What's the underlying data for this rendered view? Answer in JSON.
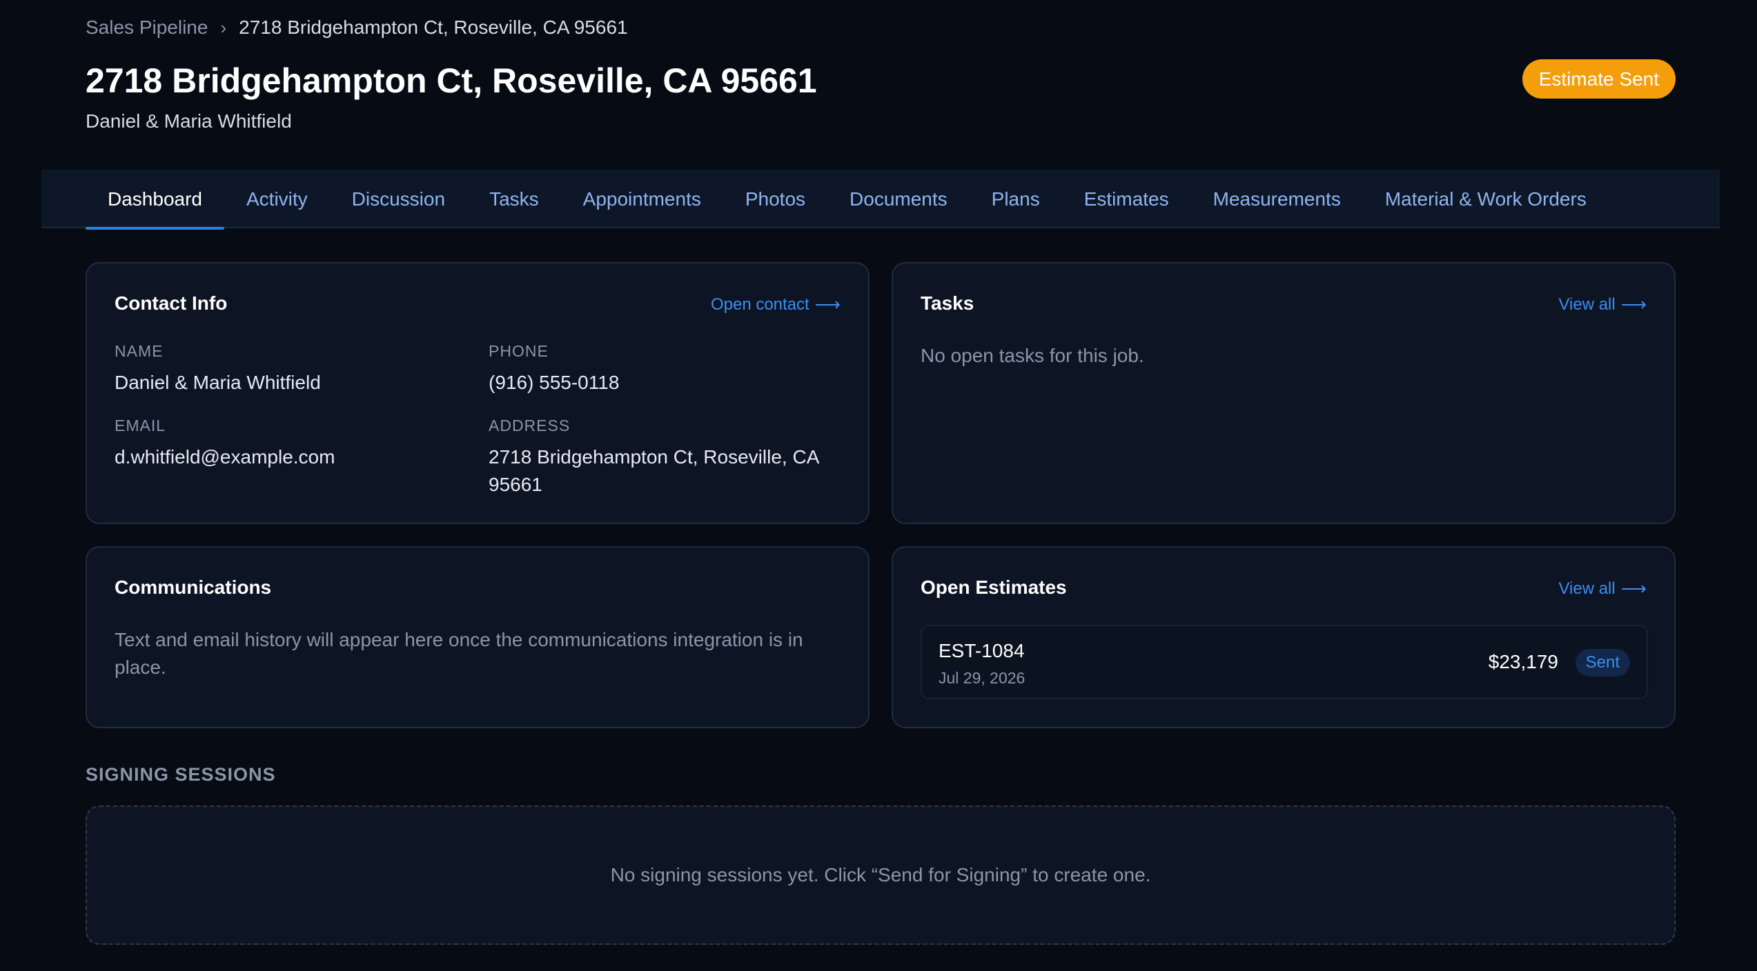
{
  "breadcrumb": {
    "parent": "Sales Pipeline",
    "separator": "›",
    "current": "2718 Bridgehampton Ct, Roseville, CA 95661"
  },
  "header": {
    "title": "2718 Bridgehampton Ct, Roseville, CA 95661",
    "subtitle": "Daniel & Maria Whitfield",
    "status": "Estimate Sent",
    "status_color": "#f59e0b"
  },
  "tabs": [
    {
      "label": "Dashboard",
      "active": true
    },
    {
      "label": "Activity"
    },
    {
      "label": "Discussion"
    },
    {
      "label": "Tasks"
    },
    {
      "label": "Appointments"
    },
    {
      "label": "Photos"
    },
    {
      "label": "Documents"
    },
    {
      "label": "Plans"
    },
    {
      "label": "Estimates"
    },
    {
      "label": "Measurements"
    },
    {
      "label": "Material & Work Orders"
    }
  ],
  "contact": {
    "title": "Contact Info",
    "link": "Open contact",
    "name_label": "NAME",
    "name": "Daniel & Maria Whitfield",
    "phone_label": "PHONE",
    "phone": "(916) 555-0118",
    "email_label": "EMAIL",
    "email": "d.whitfield@example.com",
    "address_label": "ADDRESS",
    "address": "2718 Bridgehampton Ct, Roseville, CA 95661"
  },
  "tasks": {
    "title": "Tasks",
    "link": "View all",
    "empty": "No open tasks for this job."
  },
  "communications": {
    "title": "Communications",
    "empty": "Text and email history will appear here once the communications integration is in place."
  },
  "estimates": {
    "title": "Open Estimates",
    "link": "View all",
    "items": [
      {
        "number": "EST-1084",
        "date": "Jul 29, 2026",
        "amount": "$23,179",
        "status": "Sent"
      }
    ]
  },
  "signing": {
    "heading": "SIGNING SESSIONS",
    "empty": "No signing sessions yet. Click “Send for Signing” to create one."
  },
  "colors": {
    "accent": "#2f7fe6",
    "link": "#3b8ef0",
    "background": "#060b14",
    "card": "#0d1424"
  },
  "icons": {
    "link_arrow": "arrow-right-icon",
    "breadcrumb_separator": "chevron-right-icon"
  }
}
